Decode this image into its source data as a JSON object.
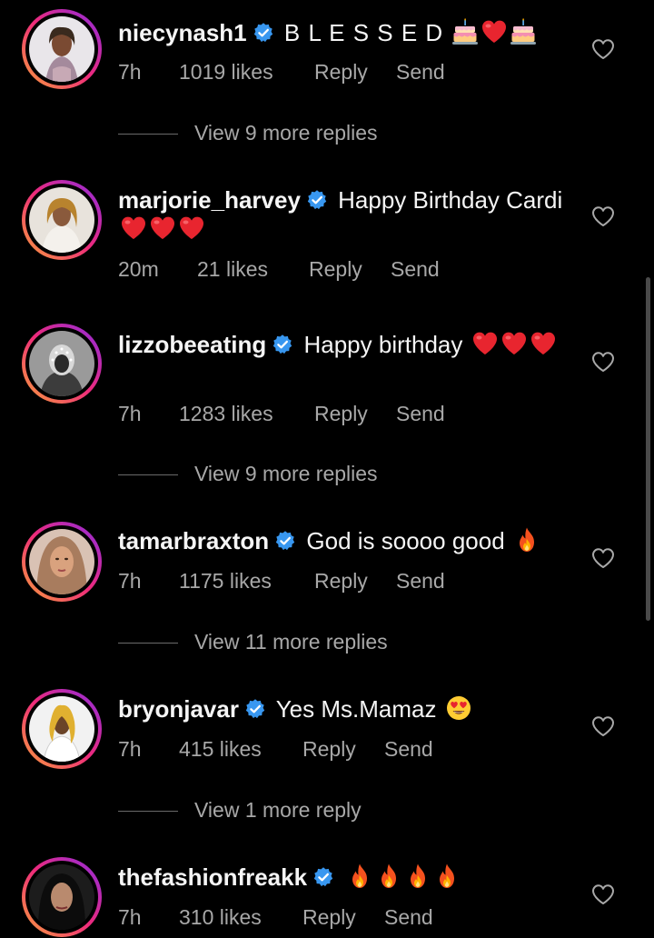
{
  "colors": {
    "background": "#000000",
    "text_primary": "#f5f5f5",
    "text_secondary": "#a8a8a8",
    "verified": "#3897f0"
  },
  "comments": [
    {
      "username": "niecynash1",
      "text": "B L E S S E D",
      "emojis": [
        "birthday-cake",
        "red-heart",
        "birthday-cake"
      ],
      "time": "7h",
      "likes": "1019 likes",
      "reply": "Reply",
      "send": "Send",
      "view_replies": "View 9 more replies"
    },
    {
      "username": "marjorie_harvey",
      "text": "Happy Birthday Cardi",
      "emojis": [
        "red-heart",
        "red-heart",
        "red-heart"
      ],
      "time": "20m",
      "likes": "21 likes",
      "reply": "Reply",
      "send": "Send"
    },
    {
      "username": "lizzobeeating",
      "text": "Happy birthday",
      "emojis": [
        "red-heart",
        "red-heart",
        "red-heart"
      ],
      "time": "7h",
      "likes": "1283 likes",
      "reply": "Reply",
      "send": "Send",
      "view_replies": "View 9 more replies"
    },
    {
      "username": "tamarbraxton",
      "text": "God is soooo good",
      "emojis": [
        "fire"
      ],
      "time": "7h",
      "likes": "1175 likes",
      "reply": "Reply",
      "send": "Send",
      "view_replies": "View 11 more replies"
    },
    {
      "username": "bryonjavar",
      "text": "Yes Ms.Mamaz",
      "emojis": [
        "heart-eyes"
      ],
      "time": "7h",
      "likes": "415 likes",
      "reply": "Reply",
      "send": "Send",
      "view_replies": "View 1 more reply"
    },
    {
      "username": "thefashionfreakk",
      "text": "",
      "emojis": [
        "fire",
        "fire",
        "fire",
        "fire"
      ],
      "time": "7h",
      "likes": "310 likes",
      "reply": "Reply",
      "send": "Send"
    }
  ]
}
